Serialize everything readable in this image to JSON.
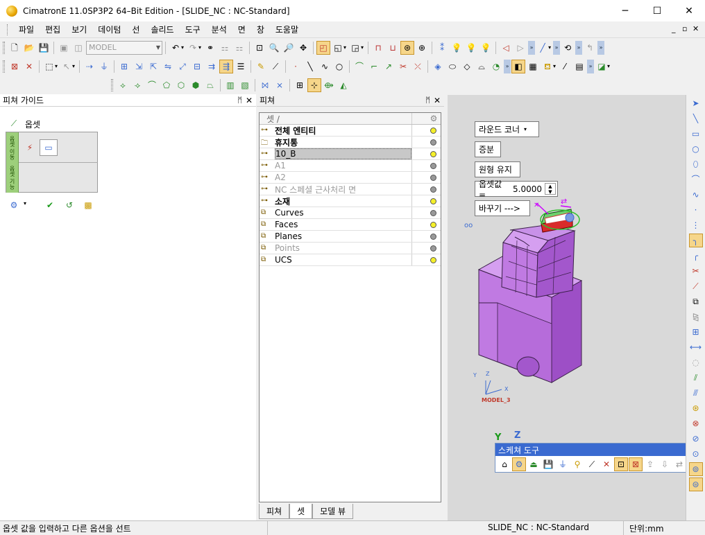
{
  "window": {
    "title": "CimatronE 11.0SP3P2 64–Bit Edition - [SLIDE_NC : NC-Standard]",
    "minimize": "─",
    "maximize": "☐",
    "close": "✕"
  },
  "menu": {
    "items": [
      "파일",
      "편집",
      "보기",
      "데이텀",
      "선",
      "솔리드",
      "도구",
      "분석",
      "면",
      "창",
      "도움말"
    ],
    "mdi_min": "_",
    "mdi_restore": "▫",
    "mdi_close": "✕"
  },
  "toolbar": {
    "model_combo": "MODEL"
  },
  "feature_guide": {
    "title": "피쳐 가이드",
    "pin": "ᛗ",
    "close": "✕",
    "offset_label": "옵셋",
    "strip_top": "옵셋 이동",
    "strip_bottom": "옵셋 기능"
  },
  "feature_panel": {
    "title": "피쳐",
    "pin": "ᛗ",
    "close": "✕",
    "column_header": "셋 /",
    "rows": [
      {
        "name": "전체 엔티티",
        "bold": true,
        "gray": false,
        "bulb": "on"
      },
      {
        "name": "휴지통",
        "bold": true,
        "gray": false,
        "bulb": "off"
      },
      {
        "name": "10_B",
        "bold": false,
        "gray": false,
        "bulb": "on",
        "selected": true
      },
      {
        "name": "A1",
        "bold": false,
        "gray": true,
        "bulb": "off"
      },
      {
        "name": "A2",
        "bold": false,
        "gray": true,
        "bulb": "off"
      },
      {
        "name": "NC 스페셜 근사처리 면",
        "bold": false,
        "gray": true,
        "bulb": "off"
      },
      {
        "name": "소재",
        "bold": true,
        "gray": false,
        "bulb": "on"
      },
      {
        "name": "Curves",
        "bold": false,
        "gray": false,
        "bulb": "off"
      },
      {
        "name": "Faces",
        "bold": false,
        "gray": false,
        "bulb": "on"
      },
      {
        "name": "Planes",
        "bold": false,
        "gray": false,
        "bulb": "off"
      },
      {
        "name": "Points",
        "bold": false,
        "gray": true,
        "bulb": "off"
      },
      {
        "name": "UCS",
        "bold": false,
        "gray": false,
        "bulb": "on"
      }
    ],
    "tabs": [
      "피쳐",
      "셋",
      "모델 뷰"
    ]
  },
  "viewport": {
    "btn_round_corner": "라운드 코너",
    "btn_increment": "증분",
    "btn_keep_circle": "원형 유지",
    "offset_label": "옵셋값 =",
    "offset_value": "5.0000",
    "btn_change": "바꾸기 --->",
    "model_label": "MODEL_3",
    "axis_y": "Y",
    "axis_z": "Z",
    "small_x": "X",
    "small_y": "Y",
    "small_z": "Z",
    "marker": "oo"
  },
  "sketch_tool": {
    "title": "스케쳐 도구",
    "close": "✕"
  },
  "status": {
    "prompt": "옵셋 값을 입력하고 다른 옵션을 선트",
    "file": "SLIDE_NC : NC-Standard",
    "unit": "단위:mm"
  },
  "colors": {
    "model_purple": "#c57be6",
    "highlight": "#f6d68a",
    "sketch_head": "#3a6ad0"
  }
}
